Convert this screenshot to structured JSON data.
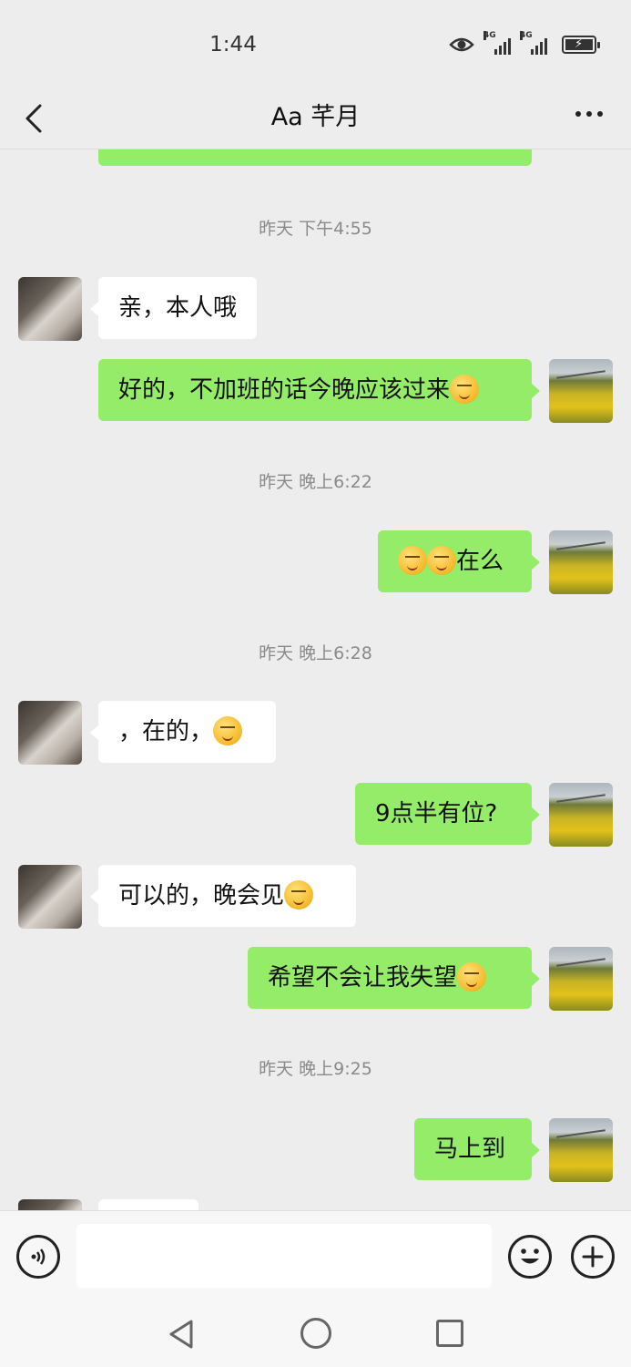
{
  "status_bar": {
    "time": "1:44",
    "icons": [
      "eye-icon",
      "signal-4g-icon",
      "signal-4g-icon",
      "battery-charging-icon"
    ],
    "network_label": "4G"
  },
  "header": {
    "title": "Aa 芊月",
    "back_icon": "chevron-left-icon",
    "more_icon": "more-dots-icon"
  },
  "messages": [
    {
      "type": "time",
      "text": "昨天 下午4:55"
    },
    {
      "type": "in",
      "text": "亲，本人哦"
    },
    {
      "type": "out",
      "text": "好的，不加班的话今晚应该过来",
      "emoji": "smirk-emoji"
    },
    {
      "type": "time",
      "text": "昨天 晚上6:22"
    },
    {
      "type": "out",
      "text": "在么",
      "emoji_prefix": [
        "666-emoji",
        "666-emoji"
      ]
    },
    {
      "type": "time",
      "text": "昨天 晚上6:28"
    },
    {
      "type": "in",
      "text": "，在的，",
      "emoji": "surprised-emoji"
    },
    {
      "type": "out",
      "text": "9点半有位?"
    },
    {
      "type": "in",
      "text": "可以的，晚会见",
      "emoji": "ok-hand-emoji"
    },
    {
      "type": "out",
      "text": "希望不会让我失望",
      "emoji": "smirk-emoji"
    },
    {
      "type": "time",
      "text": "昨天 晚上9:25"
    },
    {
      "type": "out",
      "text": "马上到"
    }
  ],
  "input_bar": {
    "voice_icon": "voice-icon",
    "input_value": "",
    "emoji_icon": "emoji-smile-icon",
    "plus_icon": "plus-icon"
  },
  "nav_bar": {
    "icons": [
      "nav-back-icon",
      "nav-home-icon",
      "nav-recent-icon"
    ]
  },
  "colors": {
    "background": "#ededed",
    "bubble_out": "#95ec69",
    "bubble_in": "#ffffff",
    "timestamp": "#8a8a8a"
  }
}
